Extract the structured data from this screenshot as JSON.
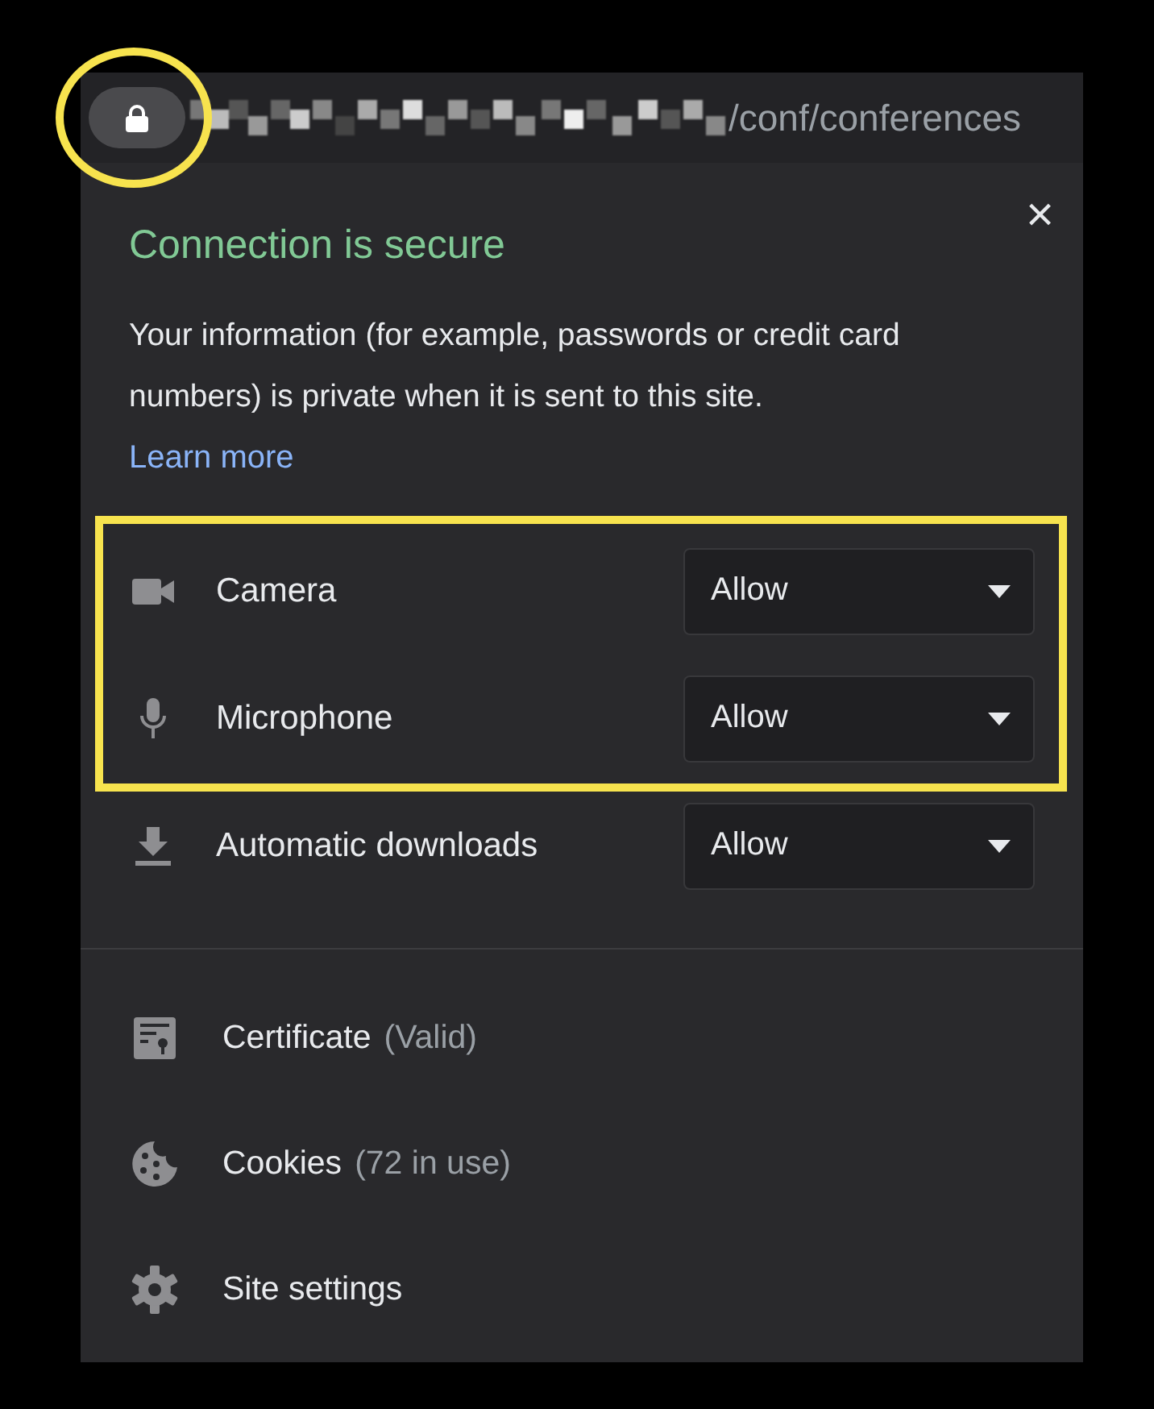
{
  "address_bar": {
    "url_visible": "/conf/conferences"
  },
  "popup": {
    "title": "Connection is secure",
    "close": "×",
    "description": "Your information (for example, passwords or credit card numbers) is private when it is sent to this site.",
    "learn_more": "Learn more"
  },
  "permissions": [
    {
      "kind": "camera",
      "label": "Camera",
      "value": "Allow"
    },
    {
      "kind": "microphone",
      "label": "Microphone",
      "value": "Allow"
    },
    {
      "kind": "download",
      "label": "Automatic downloads",
      "value": "Allow"
    }
  ],
  "items": [
    {
      "kind": "certificate",
      "label": "Certificate",
      "detail": "(Valid)"
    },
    {
      "kind": "cookies",
      "label": "Cookies",
      "detail": "(72 in use)"
    },
    {
      "kind": "settings",
      "label": "Site settings"
    }
  ]
}
